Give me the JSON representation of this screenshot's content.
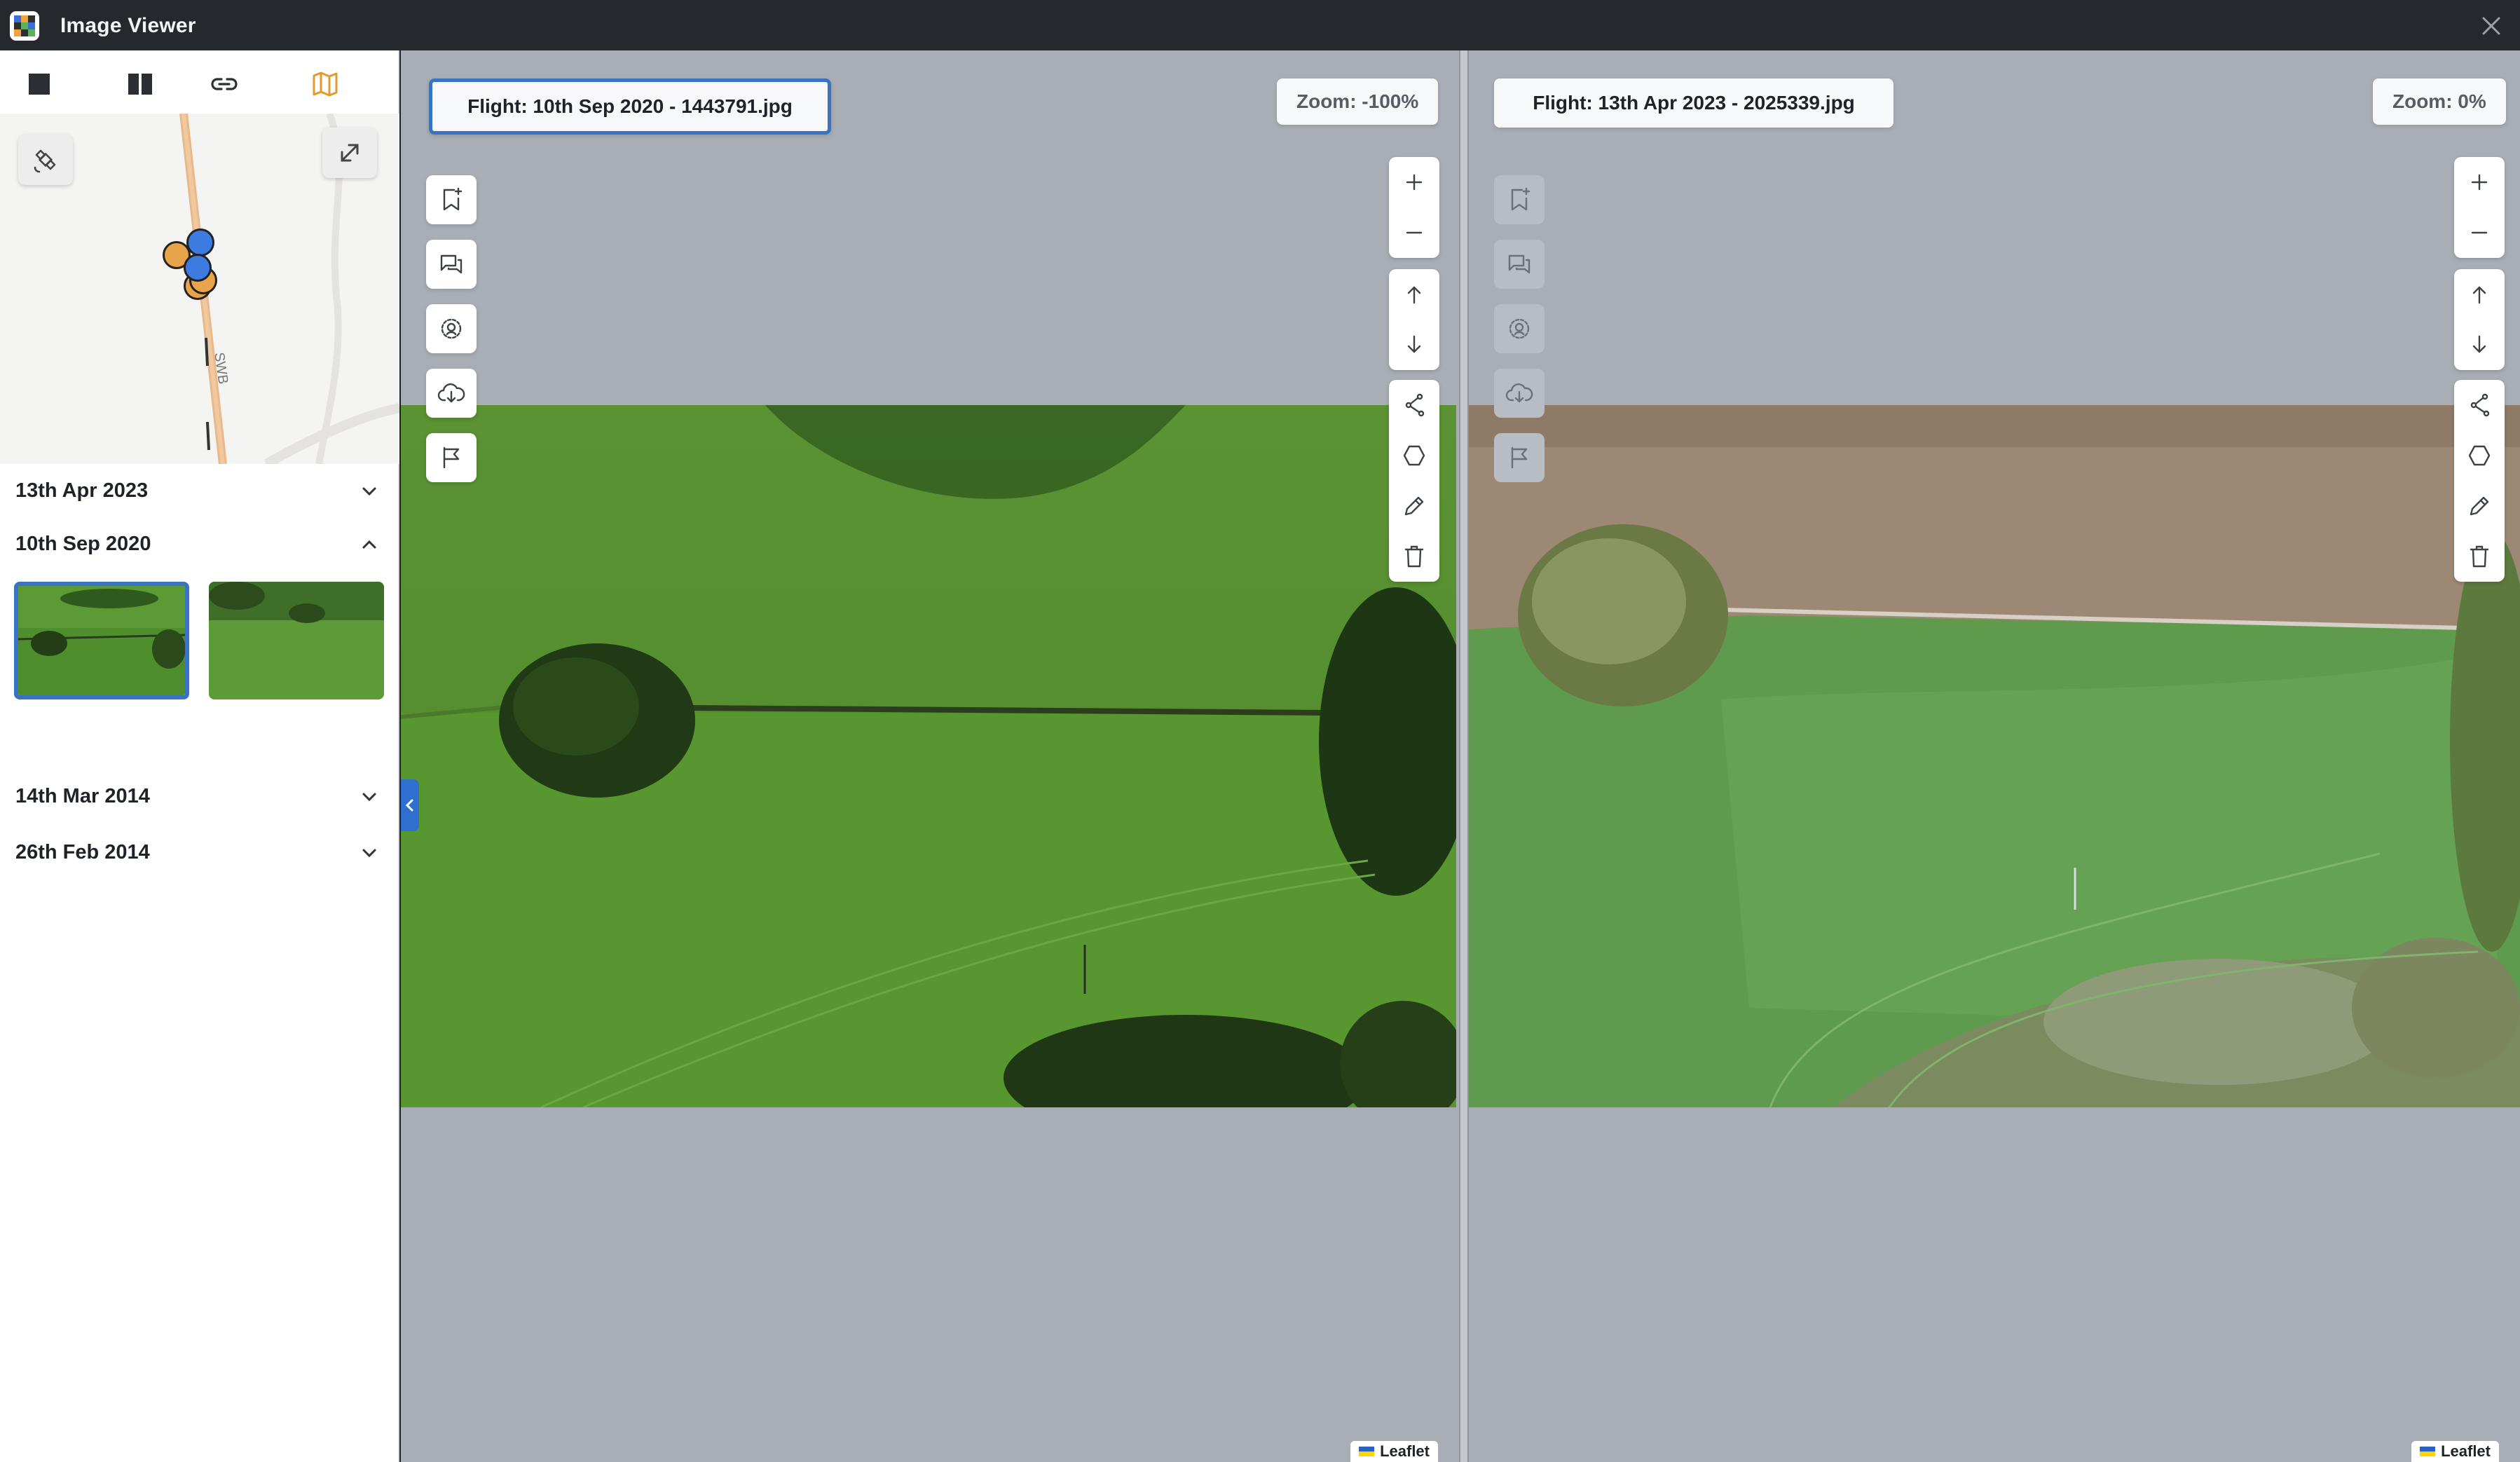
{
  "window": {
    "title": "Image Viewer"
  },
  "sidebar": {
    "view_modes": [
      {
        "name": "single-view",
        "active": false
      },
      {
        "name": "split-view",
        "active": false
      },
      {
        "name": "link",
        "active": false
      },
      {
        "name": "map-view",
        "active": true
      }
    ],
    "map": {
      "road_label": "SWB"
    },
    "groups": [
      {
        "label": "13th Apr 2023",
        "expanded": false
      },
      {
        "label": "10th Sep 2020",
        "expanded": true
      },
      {
        "label": "14th Mar 2014",
        "expanded": false
      },
      {
        "label": "26th Feb 2014",
        "expanded": false
      }
    ]
  },
  "left_pane": {
    "flight_label": "Flight: 10th Sep 2020 - 1443791.jpg",
    "zoom": "Zoom: -100%",
    "attribution": "Leaflet"
  },
  "right_pane": {
    "flight_label": "Flight: 13th Apr 2023 - 2025339.jpg",
    "zoom": "Zoom: 0%",
    "attribution": "Leaflet"
  },
  "colors": {
    "accent": "#3a73c4",
    "map_marker_orange": "#e8a44a",
    "map_marker_blue": "#3c7be0"
  }
}
